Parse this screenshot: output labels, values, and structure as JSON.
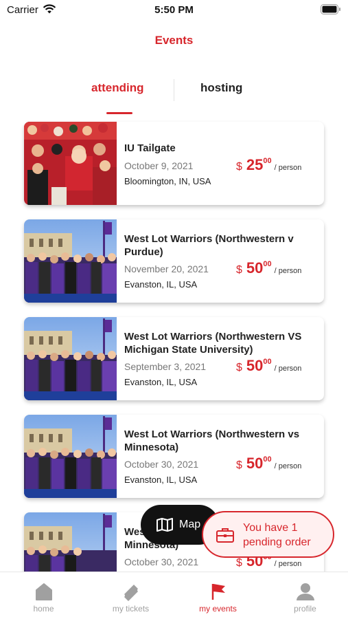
{
  "status_bar": {
    "carrier": "Carrier",
    "time": "5:50 PM"
  },
  "header": {
    "title": "Events"
  },
  "tabs": {
    "attending": "attending",
    "hosting": "hosting",
    "active": "attending"
  },
  "events": [
    {
      "title": "IU Tailgate",
      "date": "October 9, 2021",
      "location": "Bloomington, IN, USA",
      "currency": "$",
      "price_whole": "25",
      "price_cents": "00",
      "price_unit": "/ person",
      "image": "tailgate-crowd-photo"
    },
    {
      "title": "West Lot Warriors (Northwestern v Purdue)",
      "date": "November 20, 2021",
      "location": "Evanston, IL, USA",
      "currency": "$",
      "price_whole": "50",
      "price_cents": "00",
      "price_unit": "/ person",
      "image": "group-photo"
    },
    {
      "title": "West Lot Warriors (Northwestern VS Michigan State University)",
      "date": "September 3, 2021",
      "location": "Evanston, IL, USA",
      "currency": "$",
      "price_whole": "50",
      "price_cents": "00",
      "price_unit": "/ person",
      "image": "group-photo"
    },
    {
      "title": "West Lot Warriors (Northwestern vs Minnesota)",
      "date": "October 30, 2021",
      "location": "Evanston, IL, USA",
      "currency": "$",
      "price_whole": "50",
      "price_cents": "00",
      "price_unit": "/ person",
      "image": "group-photo"
    },
    {
      "title": "West Lot Warriors (Northwestern vs Minnesota)",
      "date": "October 30, 2021",
      "location": "",
      "currency": "$",
      "price_whole": "50",
      "price_cents": "00",
      "price_unit": "/ person",
      "image": "group-photo"
    }
  ],
  "map_button": {
    "label": "Map",
    "icon": "map-icon"
  },
  "pending_order": {
    "text": "You have 1 pending order",
    "icon": "briefcase-icon"
  },
  "tabbar": {
    "items": [
      {
        "label": "home",
        "icon": "home-icon"
      },
      {
        "label": "my tickets",
        "icon": "ticket-icon"
      },
      {
        "label": "my events",
        "icon": "flag-icon"
      },
      {
        "label": "profile",
        "icon": "person-icon"
      }
    ],
    "active": "my events"
  },
  "colors": {
    "accent": "#d7262c",
    "inactive": "#a0a0a0"
  }
}
